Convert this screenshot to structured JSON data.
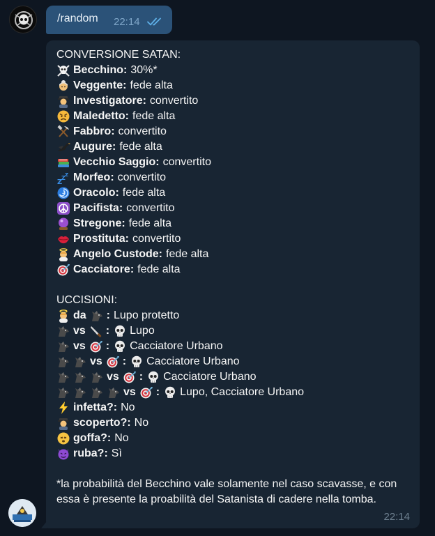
{
  "message_out": {
    "text": "/random",
    "time": "22:14",
    "status_icon": "double-check-icon"
  },
  "message_in": {
    "time": "22:14",
    "conversion_title": "CONVERSIONE SATAN:",
    "roles": [
      {
        "icon": "skull-crossbones-icon",
        "name": "Becchino:",
        "value": "30%*"
      },
      {
        "icon": "old-woman-icon",
        "name": "Veggente:",
        "value": "fede alta"
      },
      {
        "icon": "detective-icon",
        "name": "Investigatore:",
        "value": "convertito"
      },
      {
        "icon": "angry-face-icon",
        "name": "Maledetto:",
        "value": "fede alta"
      },
      {
        "icon": "hammer-pick-icon",
        "name": "Fabbro:",
        "value": "convertito"
      },
      {
        "icon": "black-bird-icon",
        "name": "Augure:",
        "value": "fede alta"
      },
      {
        "icon": "books-icon",
        "name": "Vecchio Saggio:",
        "value": "convertito"
      },
      {
        "icon": "zzz-icon",
        "name": "Morfeo:",
        "value": "convertito"
      },
      {
        "icon": "cyclone-icon",
        "name": "Oracolo:",
        "value": "fede alta"
      },
      {
        "icon": "peace-symbol-icon",
        "name": "Pacifista:",
        "value": "convertito"
      },
      {
        "icon": "crystal-ball-icon",
        "name": "Stregone:",
        "value": "fede alta"
      },
      {
        "icon": "kiss-lips-icon",
        "name": "Prostituta:",
        "value": "convertito"
      },
      {
        "icon": "baby-angel-icon",
        "name": "Angelo Custode:",
        "value": "fede alta"
      },
      {
        "icon": "target-icon",
        "name": "Cacciatore:",
        "value": "fede alta"
      }
    ],
    "kills_title": "UCCISIONI:",
    "kills": {
      "k1": {
        "da": "da",
        "result": "Lupo protetto"
      },
      "k2": {
        "vs": "vs",
        "result": "Lupo"
      },
      "k3": {
        "vs": "vs",
        "result": "Cacciatore Urbano"
      },
      "k4": {
        "vs": "vs",
        "result": "Cacciatore Urbano"
      },
      "k5": {
        "vs": "vs",
        "result": "Cacciatore Urbano"
      },
      "k6": {
        "vs": "vs",
        "result": "Lupo, Cacciatore Urbano"
      }
    },
    "questions": [
      {
        "icon": "lightning-icon",
        "label": "infetta?:",
        "value": "No"
      },
      {
        "icon": "detective-icon",
        "label": "scoperto?:",
        "value": "No"
      },
      {
        "icon": "dizzy-face-icon",
        "label": "goffa?:",
        "value": "No"
      },
      {
        "icon": "devil-face-icon",
        "label": "ruba?:",
        "value": "Sì"
      }
    ],
    "footnote": "*la probabilità del Becchino vale solamente nel caso scavasse, e con essa è presente la proabilità del Satanista di cadere nella tomba."
  },
  "colors": {
    "background": "#0e1621",
    "outgoing_bubble": "#2b5278",
    "incoming_bubble": "#182533",
    "text": "#f5f5f5",
    "time_muted": "#6d7f8f",
    "tick_blue": "#5fb0e8"
  }
}
